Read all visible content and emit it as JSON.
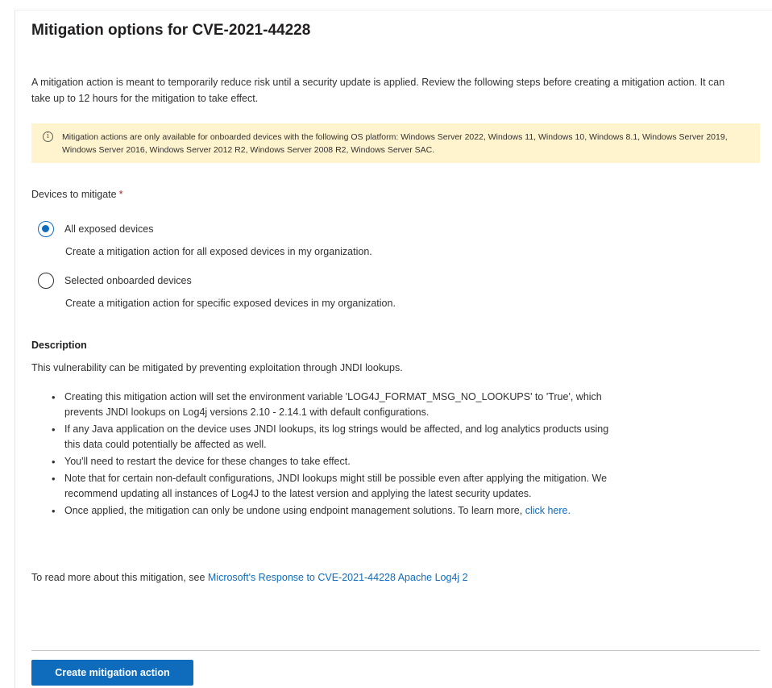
{
  "title": "Mitigation options for CVE-2021-44228",
  "intro": "A mitigation action is meant to temporarily reduce risk until a security update is applied. Review the following steps before creating a mitigation action. It can take up to 12 hours for the mitigation to take effect.",
  "warning": {
    "icon": "info-icon",
    "text": "Mitigation actions are only available for onboarded devices with the following OS platform: Windows Server 2022, Windows 11, Windows 10, Windows 8.1, Windows Server 2019, Windows Server 2016, Windows Server 2012 R2, Windows Server 2008 R2, Windows Server SAC."
  },
  "devices": {
    "label": "Devices to mitigate",
    "required_mark": "*",
    "options": [
      {
        "label": "All exposed devices",
        "help": "Create a mitigation action for all exposed devices in my organization.",
        "selected": true
      },
      {
        "label": "Selected onboarded devices",
        "help": "Create a mitigation action for specific exposed devices in my organization.",
        "selected": false
      }
    ]
  },
  "description": {
    "title": "Description",
    "lead": "This vulnerability can be mitigated by preventing exploitation through JNDI lookups.",
    "bullets": [
      "Creating this mitigation action will set the environment variable 'LOG4J_FORMAT_MSG_NO_LOOKUPS' to 'True', which prevents JNDI lookups on Log4j versions 2.10 - 2.14.1 with default configurations.",
      "If any Java application on the device uses JNDI lookups, its log strings would be affected, and log analytics products using this data could potentially be affected as well.",
      "You'll need to restart the device for these changes to take effect.",
      "Note that for certain non-default configurations, JNDI lookups might still be possible even after applying the mitigation. We recommend updating all instances of Log4J to the latest version and applying the latest security updates.",
      "Once applied, the mitigation can only be undone using endpoint management solutions. To learn more,"
    ],
    "bullet_link": "click here."
  },
  "more": {
    "text": "To read more about this mitigation, see ",
    "link": "Microsoft's Response to CVE-2021-44228 Apache Log4j 2"
  },
  "footer": {
    "primary_button": "Create mitigation action"
  },
  "colors": {
    "accent": "#0f6cbd",
    "warning_bg": "#fff4ce",
    "required": "#a4262c"
  }
}
